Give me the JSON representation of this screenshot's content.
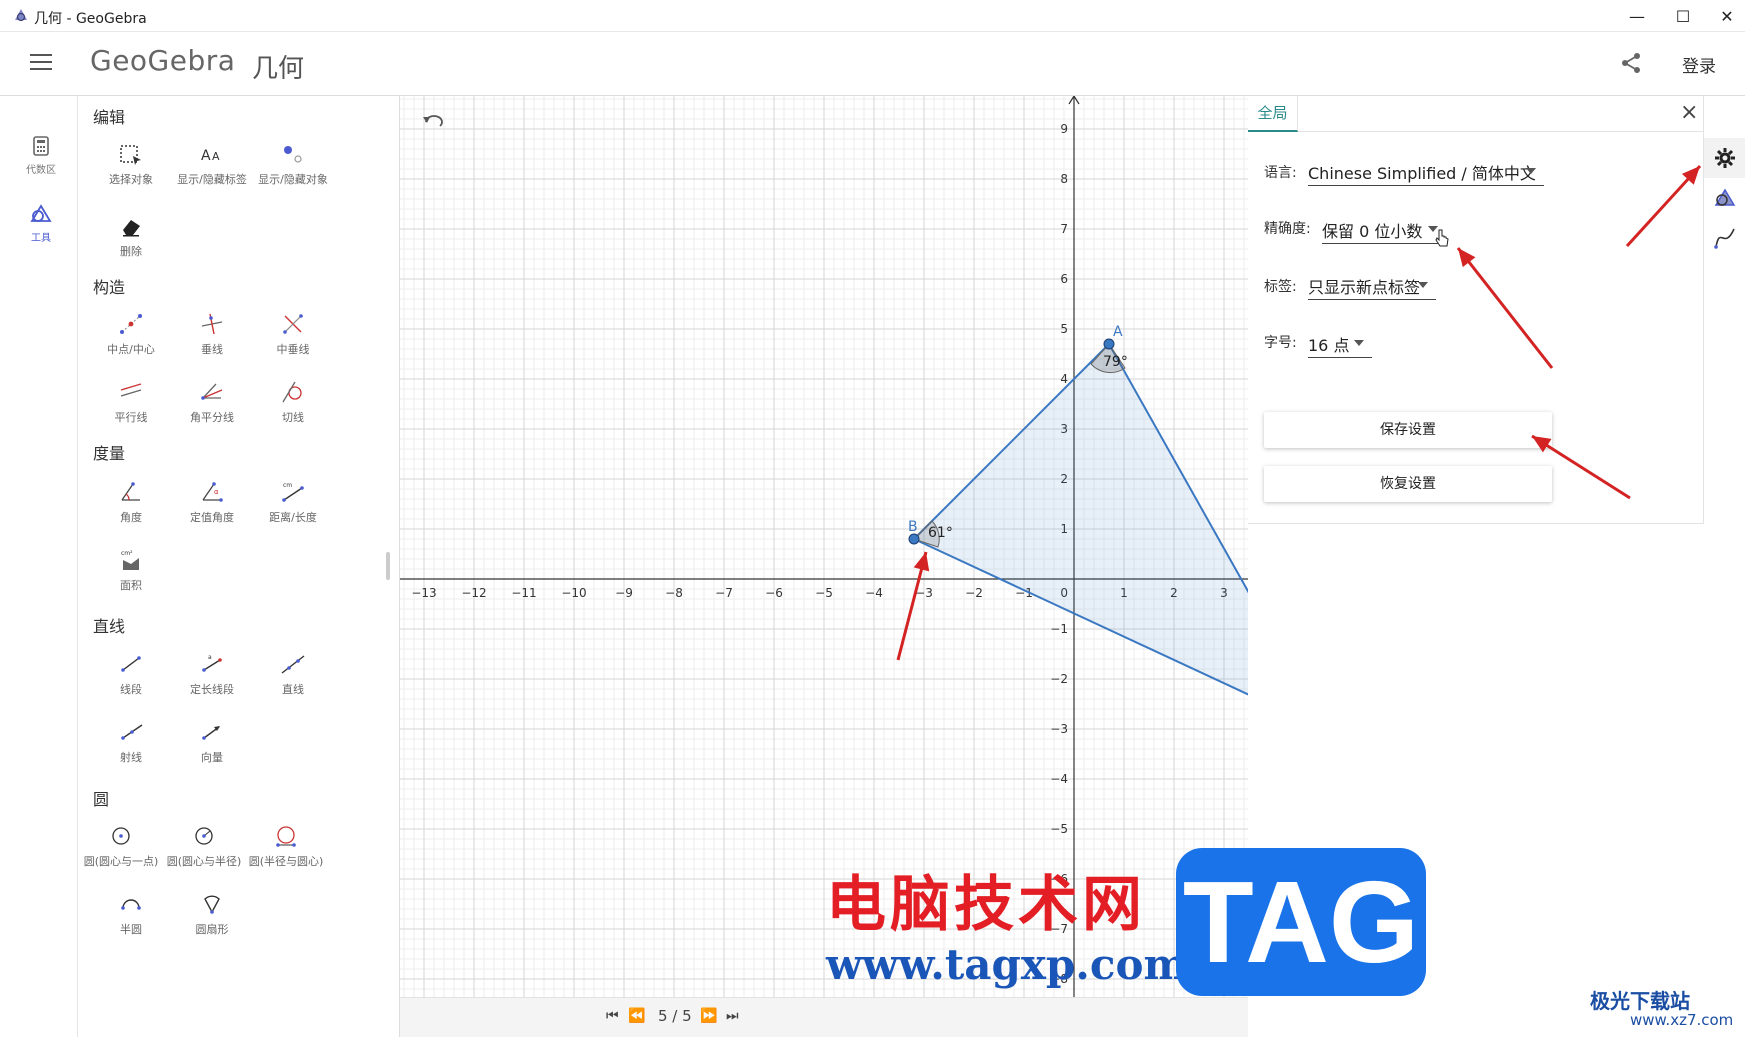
{
  "window": {
    "title": "几何 - GeoGebra",
    "minimize": "—",
    "maximize": "☐",
    "close": "✕"
  },
  "header": {
    "brand": "GeoGebra",
    "subtitle": "几何",
    "login_label": "登录"
  },
  "rail": [
    {
      "label": "代数区",
      "icon": "calculator-icon"
    },
    {
      "label": "工具",
      "icon": "tools-icon"
    }
  ],
  "tools": {
    "categories": [
      "编辑",
      "构造",
      "度量",
      "直线",
      "圆"
    ],
    "edit": [
      "选择对象",
      "显示/隐藏标签",
      "显示/隐藏对象",
      "删除"
    ],
    "construct": [
      "中点/中心",
      "垂线",
      "中垂线",
      "平行线",
      "角平分线",
      "切线"
    ],
    "measure": [
      "角度",
      "定值角度",
      "距离/长度",
      "面积"
    ],
    "lines": [
      "线段",
      "定长线段",
      "直线",
      "射线",
      "向量"
    ],
    "circles": [
      "圆(圆心与一点)",
      "圆(圆心与半径)",
      "圆(半径与圆心)",
      "半圆",
      "圆扇形"
    ]
  },
  "graphics": {
    "x_ticks": [
      -13,
      -12,
      -11,
      -10,
      -9,
      -8,
      -7,
      -6,
      -5,
      -4,
      -3,
      -2,
      -1,
      1,
      2,
      3
    ],
    "y_ticks": [
      9,
      8,
      7,
      6,
      5,
      4,
      3,
      2,
      1,
      -1,
      -2,
      -3,
      -4,
      -5,
      -6,
      -7,
      -8
    ],
    "origin_label": "0",
    "points": [
      {
        "name": "A",
        "x": 0.7,
        "y": 4.7
      },
      {
        "name": "B",
        "x": -3.2,
        "y": 0.8
      }
    ],
    "angles": [
      {
        "at": "A",
        "label": "79°"
      },
      {
        "at": "B",
        "label": "61°"
      }
    ],
    "nav": {
      "first": "⏮",
      "prev": "⏪",
      "page": "5 / 5",
      "next": "⏩",
      "last": "⏭"
    }
  },
  "settings": {
    "tab": "全局",
    "language_label": "语言:",
    "language_value": "Chinese Simplified / 简体中文",
    "precision_label": "精确度:",
    "precision_value": "保留 0 位小数",
    "labeling_label": "标签:",
    "labeling_value": "只显示新点标签",
    "fontsize_label": "字号:",
    "fontsize_value": "16 点",
    "save_button": "保存设置",
    "restore_button": "恢复设置",
    "close": "×"
  },
  "watermark": {
    "cn": "电脑技术网",
    "url": "www.tagxp.com",
    "tag": "TAG",
    "site": "极光下载站",
    "site_url": "www.xz7.com"
  },
  "colors": {
    "accent": "#2a8a8a",
    "geometry_blue": "#3b78c2",
    "arrow_red": "#d42323"
  }
}
